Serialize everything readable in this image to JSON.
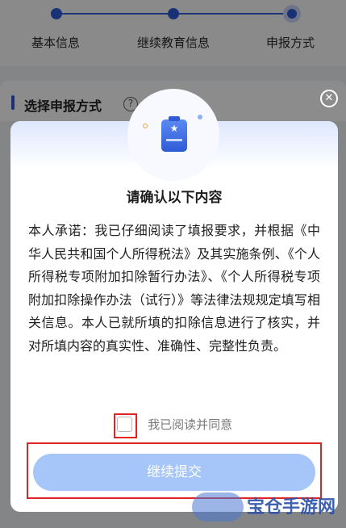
{
  "stepper": {
    "steps": [
      {
        "label": "基本信息",
        "state": "done"
      },
      {
        "label": "继续教育信息",
        "state": "done"
      },
      {
        "label": "申报方式",
        "state": "active"
      }
    ],
    "accent_color": "#2f5bd6"
  },
  "section": {
    "title": "选择申报方式",
    "help_icon": "question-circle-icon"
  },
  "dialog": {
    "close_icon": "close-circle-icon",
    "badge_icon": "document-star-icon",
    "title": "请确认以下内容",
    "body": "本人承诺：我已仔细阅读了填报要求，并根据《中华人民共和国个人所得税法》及其实施条例、《个人所得税专项附加扣除暂行办法》、《个人所得税专项附加扣除操作办法（试行）》等法律法规规定填写相关信息。本人已就所填的扣除信息进行了核实，并对所填内容的真实性、准确性、完整性负责。",
    "agree_label": "我已阅读并同意",
    "agree_checked": false,
    "continue_label": "继续提交",
    "button_color": "#a6c5f9"
  },
  "watermark": {
    "text": "宝仓手游网"
  }
}
